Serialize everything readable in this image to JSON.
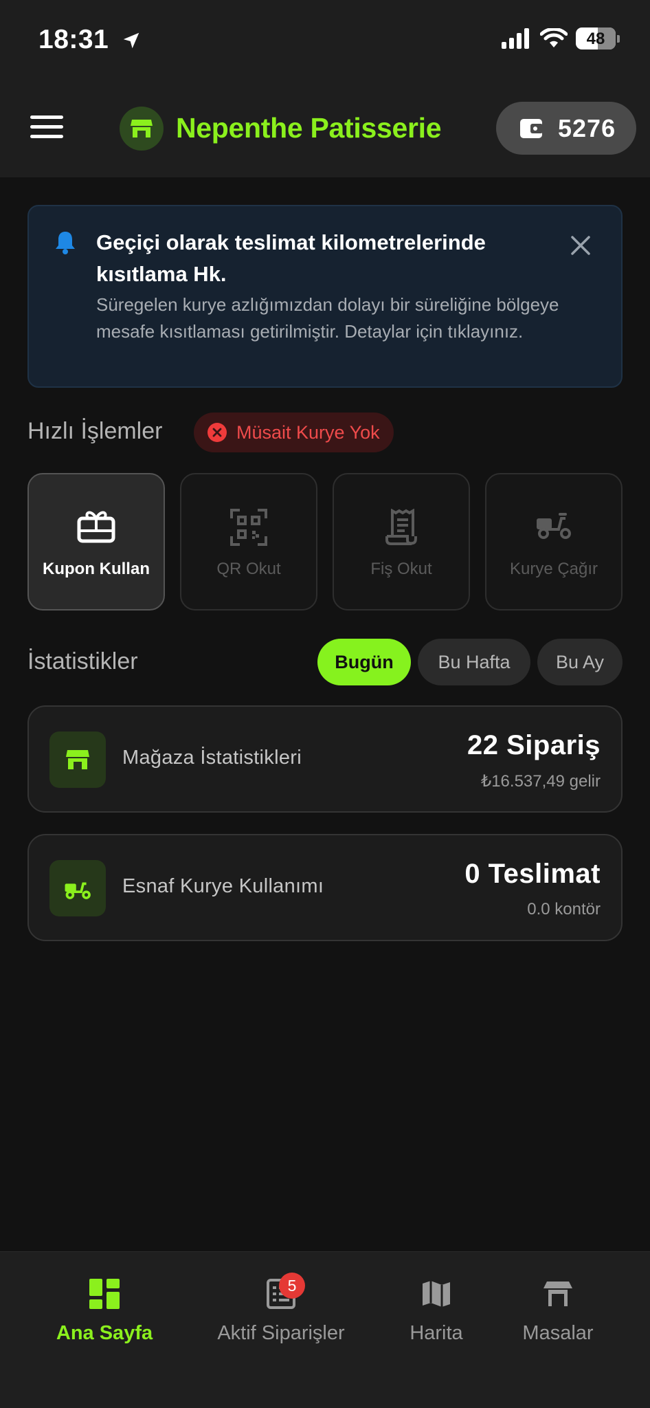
{
  "status_bar": {
    "time": "18:31",
    "battery": "48"
  },
  "header": {
    "store_name": "Nepenthe Patisserie",
    "balance": "5276",
    "menu_icon": "hamburger-icon",
    "store_icon": "store-icon",
    "wallet_icon": "wallet-icon"
  },
  "notice": {
    "title": "Geçiçi olarak teslimat kilometrelerinde kısıtlama Hk.",
    "body": "Süregelen kurye azlığımızdan dolayı bir süreliğine bölgeye mesafe kısıtlaması getirilmiştir. Detaylar için tıklayınız.",
    "icon": "bell-icon",
    "accent": "#1e88e5"
  },
  "quick_actions": {
    "title": "Hızlı İşlemler",
    "courier_status": "Müsait Kurye Yok",
    "items": [
      {
        "label": "Kupon Kullan",
        "icon": "gift-card-icon",
        "enabled": true
      },
      {
        "label": "QR Okut",
        "icon": "qr-code-icon",
        "enabled": false
      },
      {
        "label": "Fiş Okut",
        "icon": "receipt-icon",
        "enabled": false
      },
      {
        "label": "Kurye Çağır",
        "icon": "scooter-icon",
        "enabled": false
      }
    ]
  },
  "stats": {
    "title": "İstatistikler",
    "periods": [
      "Bugün",
      "Bu Hafta",
      "Bu Ay"
    ],
    "selected_period": "Bugün",
    "cards": [
      {
        "label": "Mağaza İstatistikleri",
        "main": "22 Sipariş",
        "sub": "₺16.537,49 gelir",
        "icon": "store-icon"
      },
      {
        "label": "Esnaf Kurye Kullanımı",
        "main": "0 Teslimat",
        "sub": "0.0 kontör",
        "icon": "scooter-icon"
      }
    ]
  },
  "bottom_nav": {
    "items": [
      {
        "label": "Ana Sayfa",
        "icon": "dashboard-icon",
        "active": true
      },
      {
        "label": "Aktif Siparişler",
        "icon": "orders-icon",
        "badge": "5"
      },
      {
        "label": "Harita",
        "icon": "map-icon"
      },
      {
        "label": "Masalar",
        "icon": "table-icon"
      }
    ]
  },
  "colors": {
    "accent": "#8bf01d",
    "danger": "#ef4b4b",
    "background": "#121212"
  }
}
